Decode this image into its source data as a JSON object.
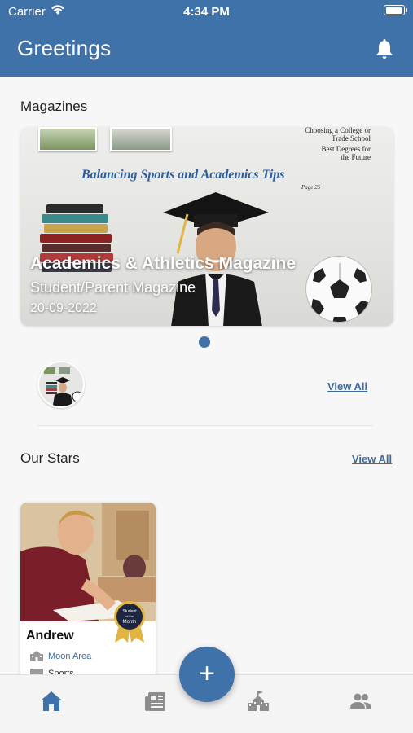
{
  "status_bar": {
    "carrier": "Carrier",
    "time": "4:34 PM"
  },
  "header": {
    "title": "Greetings",
    "icon": "bell-icon"
  },
  "magazines": {
    "section_title": "Magazines",
    "carousel": {
      "title": "Academics & Athletics Magazine",
      "subtitle": "Student/Parent Magazine",
      "date": "20-09-2022",
      "cover_lines": [
        "Choosing a College or",
        "Trade School",
        "Best Degrees for",
        "the Future"
      ],
      "cover_banner": "Balancing Sports and Academics Tips",
      "cover_page": "Page 25"
    },
    "view_all": "View All"
  },
  "our_stars": {
    "section_title": "Our Stars",
    "view_all": "View All",
    "cards": [
      {
        "name": "Andrew",
        "location": "Moon Area",
        "category": "Sports",
        "badge_lines": [
          "Student",
          "of the",
          "Month"
        ]
      }
    ]
  },
  "fab": {
    "label": "+"
  },
  "bottom_nav": [
    "home-icon",
    "newspaper-icon",
    "school-icon",
    "people-icon"
  ],
  "colors": {
    "primary": "#3f72a8",
    "link": "#3f6aa0"
  }
}
